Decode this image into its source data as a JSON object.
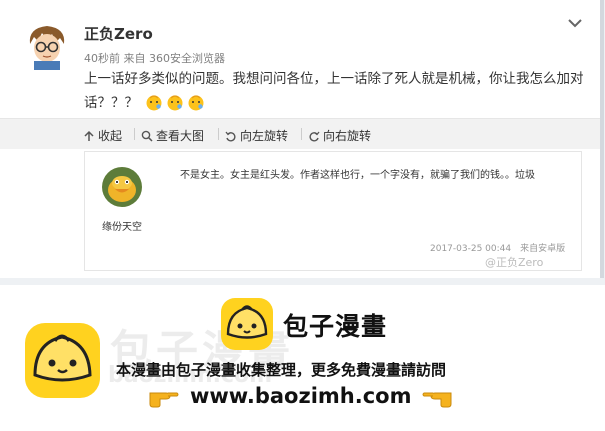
{
  "post": {
    "username": "正负Zero",
    "meta": "40秒前 来自 360安全浏览器",
    "text": "上一话好多类似的问题。我想问问各位，上一话除了死人就是机械，你让我怎么加对话？？？"
  },
  "toolbar": {
    "collect": "收起",
    "view_large": "查看大图",
    "rotate_left": "向左旋转",
    "rotate_right": "向右旋转"
  },
  "comment": {
    "name": "缘份天空",
    "text": "不是女主。女主是红头发。作者这样也行，一个字没有，就骗了我们的钱。。垃圾",
    "time": "2017-03-25 00:44　来自安卓版",
    "watermark": "@正负Zero"
  },
  "promo": {
    "brand": "包子漫畫",
    "ghost": "包子漫畫",
    "ghost_url": "baozimh.com",
    "text": "本漫畫由包子漫畫收集整理，更多免費漫畫請訪問",
    "url": "www.baozimh.com"
  },
  "colors": {
    "bun_yellow": "#ffd21f",
    "bg_gray": "#eef1f4"
  }
}
